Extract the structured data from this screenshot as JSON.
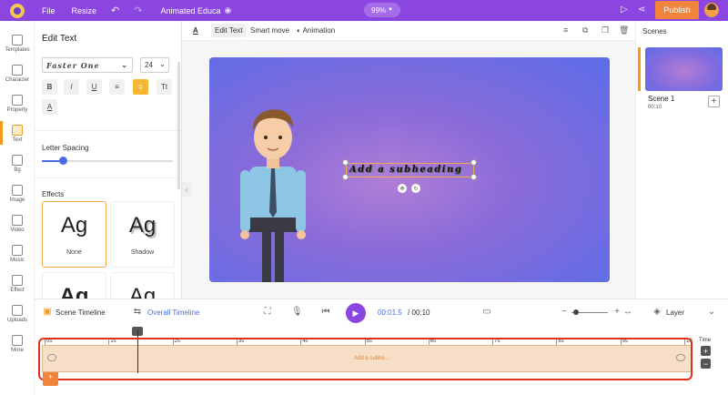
{
  "topbar": {
    "file": "File",
    "resize": "Resize",
    "doc_title": "Animated Educa",
    "zoom": "99%",
    "publish": "Publish"
  },
  "rail": [
    {
      "label": "Templates",
      "icon": "templates-icon"
    },
    {
      "label": "Character",
      "icon": "character-icon"
    },
    {
      "label": "Property",
      "icon": "property-icon"
    },
    {
      "label": "Text",
      "icon": "text-icon",
      "active": true
    },
    {
      "label": "Bg",
      "icon": "bg-icon"
    },
    {
      "label": "Image",
      "icon": "image-icon"
    },
    {
      "label": "Video",
      "icon": "video-icon"
    },
    {
      "label": "Music",
      "icon": "music-icon"
    },
    {
      "label": "Effect",
      "icon": "effect-icon"
    },
    {
      "label": "Uploads",
      "icon": "uploads-icon"
    },
    {
      "label": "More",
      "icon": "more-icon"
    }
  ],
  "panel": {
    "title": "Edit Text",
    "font": "Faster One",
    "size": "24",
    "format_buttons": [
      "B",
      "I",
      "U",
      "≡",
      "≑",
      "Tt"
    ],
    "color_button": "A",
    "letter_spacing_label": "Letter Spacing",
    "effects_label": "Effects",
    "effects": [
      {
        "glyph": "Ag",
        "name": "None"
      },
      {
        "glyph": "Ag",
        "name": "Shadow"
      },
      {
        "glyph": "Ag"
      },
      {
        "glyph": "Ag"
      }
    ]
  },
  "canvas_toolbar": {
    "edit_text": "Edit Text",
    "smart_move": "Smart move",
    "animation": "Animation"
  },
  "stage": {
    "text": "Add a subheading"
  },
  "scenes": {
    "title": "Scenes",
    "items": [
      {
        "name": "Scene 1",
        "duration": "00:10"
      }
    ]
  },
  "timeline": {
    "scene_timeline": "Scene Timeline",
    "overall_timeline": "Overall Timeline",
    "current_time": "00:01.5",
    "total_time": "/ 00:10",
    "layer": "Layer",
    "time_label": "Time",
    "ruler": [
      "0s",
      "1s",
      "2s",
      "3s",
      "4s",
      "5s",
      "6s",
      "7s",
      "8s",
      "9s",
      "10"
    ],
    "track_label": "Add a subhe..."
  },
  "colors": {
    "brand": "#8b45e0",
    "accent": "#f0843c",
    "highlight": "#e2321f"
  }
}
